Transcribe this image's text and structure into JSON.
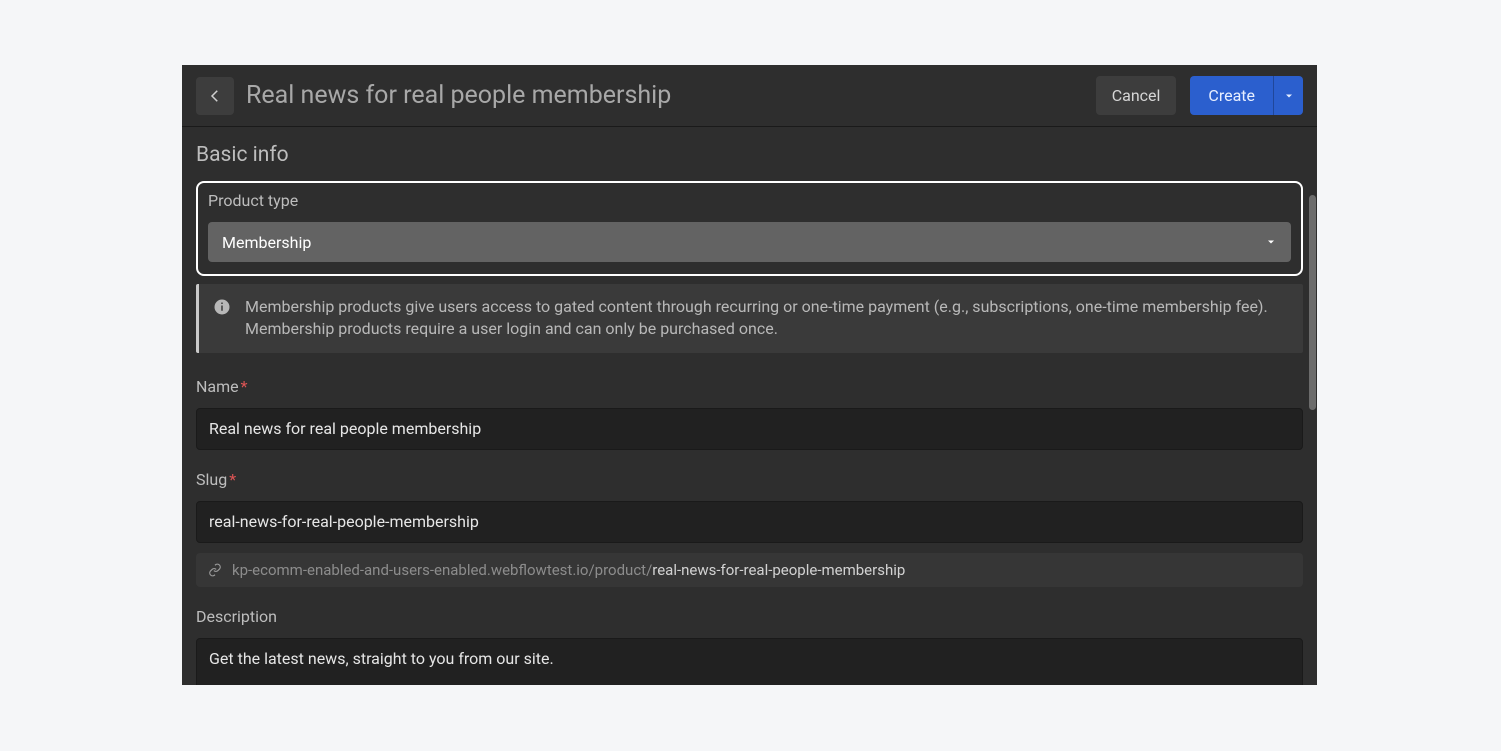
{
  "header": {
    "title": "Real news for real people membership",
    "cancel_label": "Cancel",
    "create_label": "Create"
  },
  "section_title": "Basic info",
  "product_type": {
    "label": "Product type",
    "value": "Membership"
  },
  "info_text": "Membership products give users access to gated content through recurring or one-time payment (e.g., subscriptions, one-time membership fee). Membership products require a user login and can only be purchased once.",
  "name": {
    "label": "Name",
    "required": "*",
    "value": "Real news for real people membership"
  },
  "slug": {
    "label": "Slug",
    "required": "*",
    "value": "real-news-for-real-people-membership",
    "url_base": "kp-ecomm-enabled-and-users-enabled.webflowtest.io/product/",
    "url_slug": "real-news-for-real-people-membership"
  },
  "description": {
    "label": "Description",
    "value": "Get the latest news, straight to you from our site."
  }
}
